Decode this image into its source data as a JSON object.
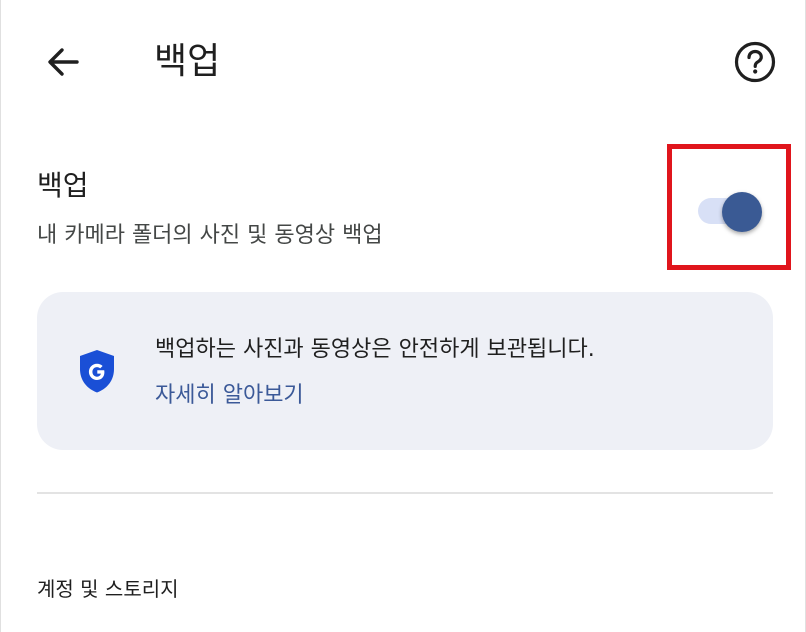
{
  "header": {
    "title": "백업"
  },
  "backup_setting": {
    "title": "백업",
    "description": "내 카메라 폴더의 사진 및 동영상 백업",
    "toggle_on": true
  },
  "info_card": {
    "text": "백업하는 사진과 동영상은 안전하게 보관됩니다.",
    "link": "자세히 알아보기"
  },
  "section": {
    "label": "계정 및 스토리지"
  },
  "colors": {
    "toggle_thumb": "#3a5a94",
    "toggle_track": "#d8e0f6",
    "link": "#3b5998",
    "highlight": "#e0151c",
    "card_bg": "#eef0f6",
    "shield": "#1a4fd6"
  },
  "icons": {
    "back": "arrow-left-icon",
    "help": "help-circle-icon",
    "shield": "google-shield-icon"
  }
}
